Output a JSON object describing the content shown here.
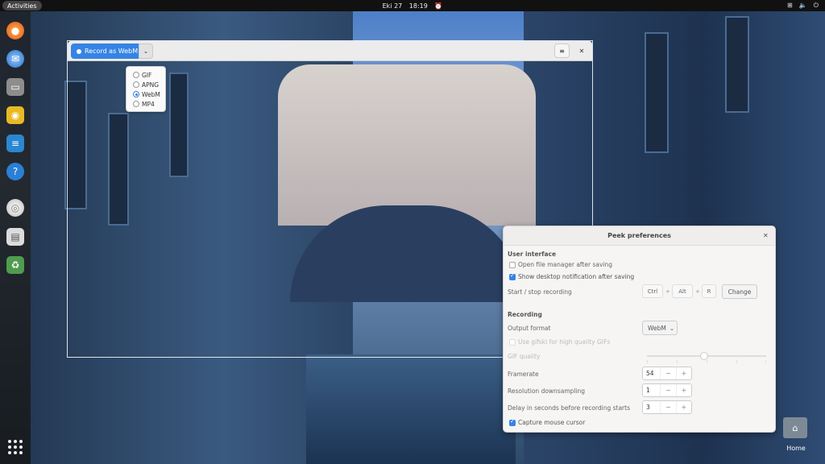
{
  "topbar": {
    "activities": "Activities",
    "date": "Eki 27",
    "time": "18:19"
  },
  "dock": {
    "apps": [
      "firefox-icon",
      "thunderbird-icon",
      "files-icon",
      "rhythmbox-icon",
      "writer-icon",
      "help-icon",
      "disc-icon",
      "drive-icon",
      "trash-icon"
    ]
  },
  "desktop": {
    "home_label": "Home"
  },
  "peek": {
    "record_label": "Record as WebM",
    "formats": [
      {
        "label": "GIF",
        "selected": false
      },
      {
        "label": "APNG",
        "selected": false
      },
      {
        "label": "WebM",
        "selected": true
      },
      {
        "label": "MP4",
        "selected": false
      }
    ]
  },
  "prefs": {
    "title": "Peek preferences",
    "ui_section": "User interface",
    "open_fm": "Open file manager after saving",
    "open_fm_checked": false,
    "show_notif": "Show desktop notification after saving",
    "show_notif_checked": true,
    "start_stop": "Start / stop recording",
    "keys": [
      "Ctrl",
      "Alt",
      "R"
    ],
    "change": "Change",
    "rec_section": "Recording",
    "output_format": "Output format",
    "output_value": "WebM",
    "gifski": "Use gifski for high quality GIFs",
    "gif_quality": "GIF quality",
    "framerate": "Framerate",
    "framerate_value": "54",
    "downsampling": "Resolution downsampling",
    "downsampling_value": "1",
    "delay": "Delay in seconds before recording starts",
    "delay_value": "3",
    "capture": "Capture mouse cursor",
    "capture_checked": true
  }
}
